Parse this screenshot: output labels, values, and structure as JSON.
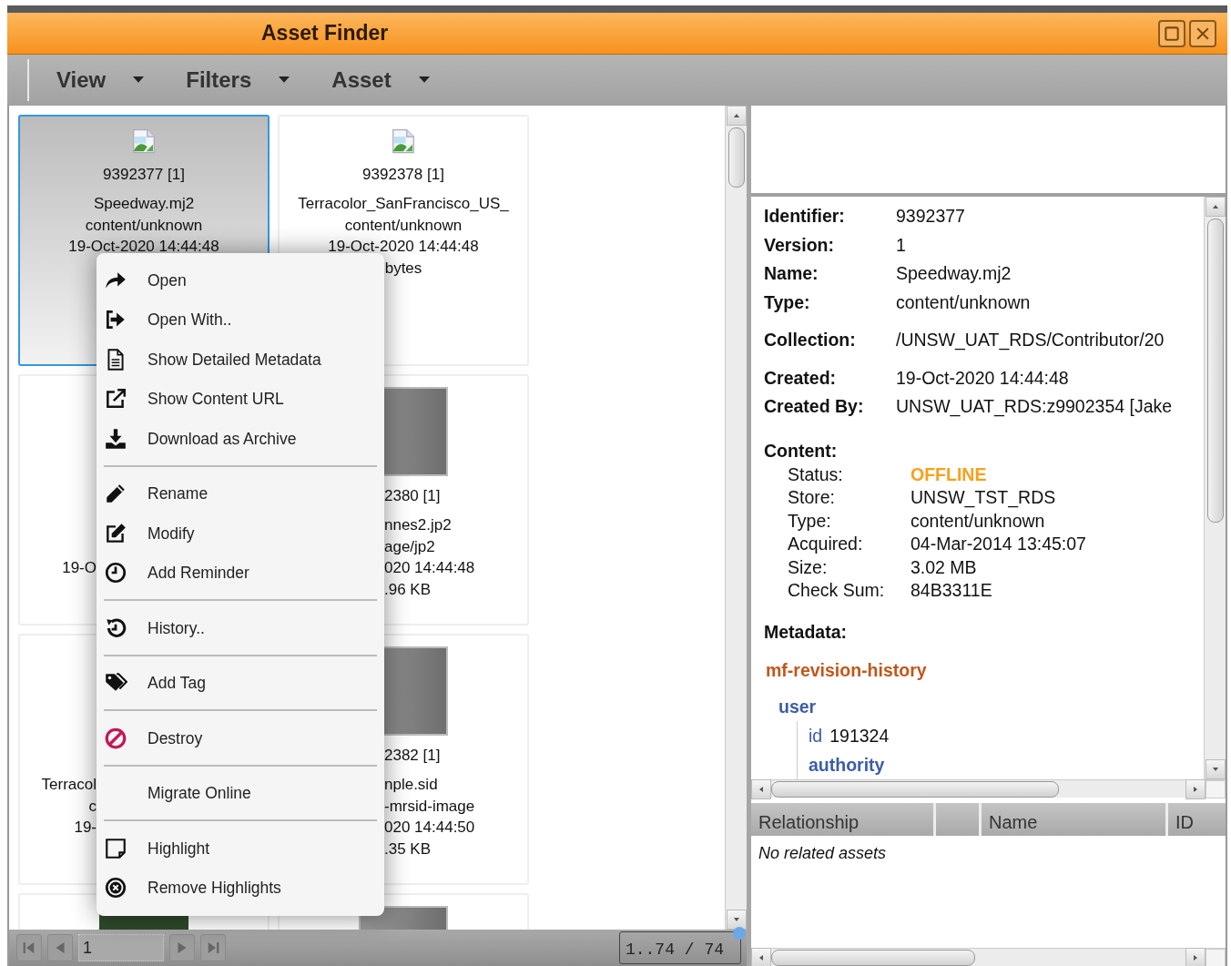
{
  "window": {
    "title": "Asset Finder"
  },
  "toolbar": {
    "menus": [
      {
        "label": "View"
      },
      {
        "label": "Filters"
      },
      {
        "label": "Asset"
      }
    ]
  },
  "tiles": [
    {
      "selected": true,
      "kind": "icon",
      "id": "9392377 [1]",
      "name": "Speedway.mj2",
      "type": "content/unknown",
      "date": "19-Oct-2020 14:44:48"
    },
    {
      "selected": false,
      "kind": "icon",
      "id": "9392378 [1]",
      "name": "Terracolor_SanFrancisco_US_",
      "type": "content/unknown",
      "date": "19-Oct-2020 14:44:48",
      "size": "bytes"
    },
    {
      "selected": false,
      "kind": "cut-left",
      "date": "19-O"
    },
    {
      "selected": false,
      "kind": "cut-right",
      "id": "2380 [1]",
      "name": "nnes2.jp2",
      "type": "age/jp2",
      "date": "020 14:44:48",
      "size": ".96 KB"
    },
    {
      "selected": false,
      "kind": "cut-left",
      "name": "Terracol",
      "type": "c",
      "date": "19-"
    },
    {
      "selected": false,
      "kind": "cut-right",
      "id": "2382 [1]",
      "name": "nple.sid",
      "type": "-mrsid-image",
      "date": "020 14:44:50",
      "size": ".35 KB"
    },
    {
      "selected": false,
      "kind": "photo"
    },
    {
      "selected": false,
      "kind": "thumbnail"
    }
  ],
  "context_menu": {
    "groups": [
      [
        {
          "label": "Open"
        },
        {
          "label": "Open With.."
        },
        {
          "label": "Show Detailed Metadata"
        },
        {
          "label": "Show Content URL"
        },
        {
          "label": "Download as Archive"
        }
      ],
      [
        {
          "label": "Rename"
        },
        {
          "label": "Modify"
        },
        {
          "label": "Add Reminder"
        }
      ],
      [
        {
          "label": "History.."
        }
      ],
      [
        {
          "label": "Add Tag"
        }
      ],
      [
        {
          "label": "Destroy"
        }
      ],
      [
        {
          "label": "Migrate Online"
        }
      ],
      [
        {
          "label": "Highlight"
        },
        {
          "label": "Remove Highlights"
        }
      ]
    ]
  },
  "pager": {
    "page": "1",
    "range": "1..74 / 74"
  },
  "details": {
    "field_groups": [
      [
        {
          "label": "Identifier:",
          "value": "9392377"
        },
        {
          "label": "Version:",
          "value": "1"
        },
        {
          "label": "Name:",
          "value": "Speedway.mj2"
        },
        {
          "label": "Type:",
          "value": "content/unknown"
        }
      ],
      [
        {
          "label": "Collection:",
          "value": "/UNSW_UAT_RDS/Contributor/20"
        }
      ],
      [
        {
          "label": "Created:",
          "value": "19-Oct-2020 14:44:48"
        },
        {
          "label": "Created By:",
          "value": "UNSW_UAT_RDS:z9902354 [Jake"
        }
      ]
    ],
    "content": {
      "title": "Content:",
      "rows": [
        {
          "kind": "status",
          "label": "Status:",
          "value": "OFFLINE"
        },
        {
          "kind": "plain",
          "label": "Store:",
          "value": "UNSW_TST_RDS"
        },
        {
          "kind": "plain",
          "label": "Type:",
          "value": "content/unknown"
        },
        {
          "kind": "plain",
          "label": "Acquired:",
          "value": "04-Mar-2014 13:45:07"
        },
        {
          "kind": "plain",
          "label": "Size:",
          "value": "3.02 MB"
        },
        {
          "kind": "plain",
          "label": "Check Sum:",
          "value": "84B3311E"
        }
      ]
    },
    "metadata": {
      "title": "Metadata:",
      "tree": [
        {
          "name": "mf-revision-history",
          "children": [
            {
              "name": "user",
              "children": [
                {
                  "name": "id",
                  "value": "191324"
                },
                {
                  "name": "authority"
                }
              ]
            }
          ]
        }
      ]
    }
  },
  "relationships": {
    "columns": [
      {
        "label": "Relationship"
      },
      {},
      {
        "label": "Name"
      },
      {
        "label": "ID"
      }
    ],
    "empty_text": "No related assets"
  }
}
